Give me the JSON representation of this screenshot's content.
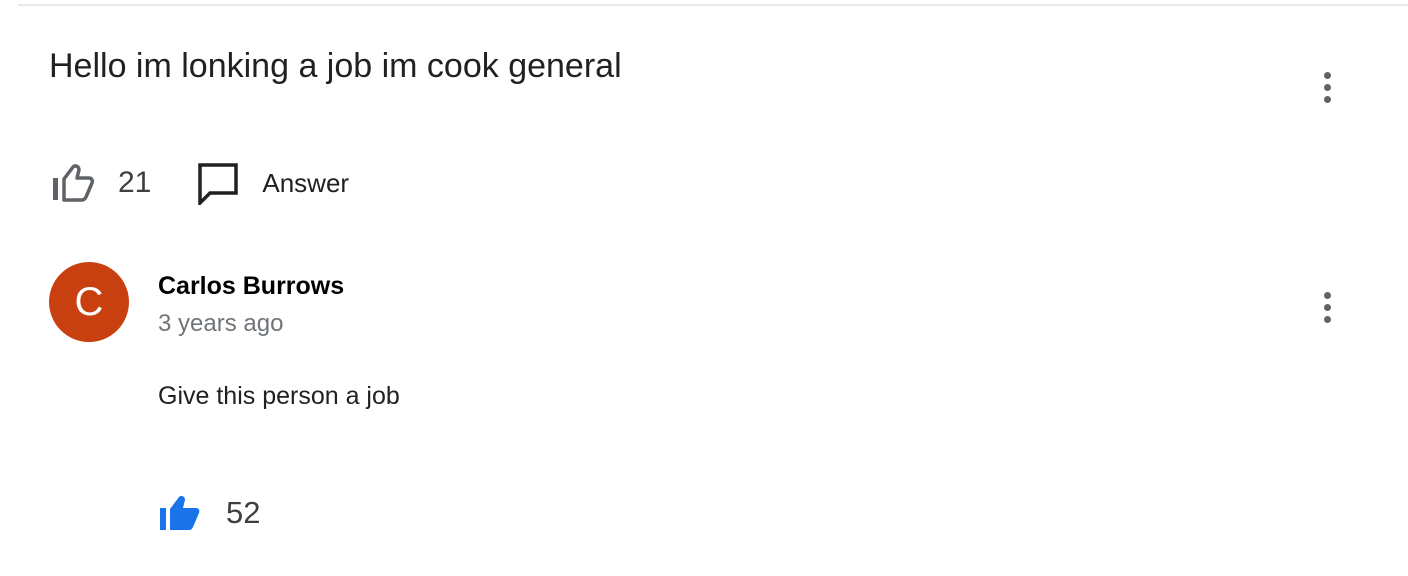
{
  "question": {
    "text": "Hello im lonking a job im cook general",
    "like_count": "21",
    "answer_label": "Answer",
    "more_icon": "more-vert-icon"
  },
  "answer": {
    "avatar_initial": "C",
    "avatar_color": "#c8400f",
    "author": "Carlos Burrows",
    "timestamp": "3 years ago",
    "text": "Give this person a job",
    "like_count": "52",
    "liked": true,
    "like_color": "#1a73e8",
    "more_icon": "more-vert-icon"
  }
}
